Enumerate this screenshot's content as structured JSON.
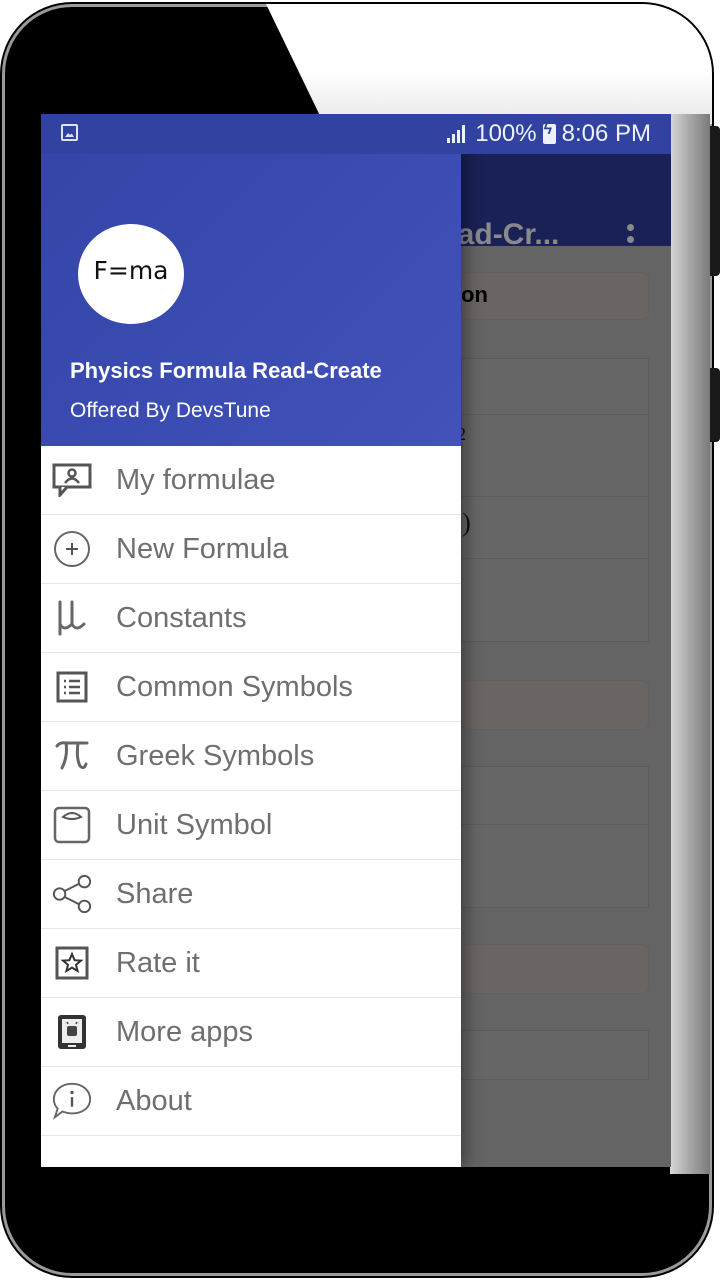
{
  "status_bar": {
    "battery": "100%",
    "time": "8:06 PM",
    "left_icon": "gallery-icon",
    "signal_icon": "signal-icon",
    "battery_icon": "battery-charging-icon"
  },
  "app_behind": {
    "toolbar_title": "Physics Formula Read-Cr...",
    "toolbar_title_visible": "ead-Cr...",
    "overflow_icon": "more-vert-icon",
    "section_heading_fragment": "on",
    "math_fragment_1": "2",
    "math_fragment_2": "₀)"
  },
  "drawer": {
    "logo_text": "F=ma",
    "app_name": "Physics Formula Read-Create",
    "offered_by": "Offered By DevsTune",
    "items": [
      {
        "label": "My formulae",
        "icon": "person-board-icon"
      },
      {
        "label": "New Formula",
        "icon": "add-circle-icon"
      },
      {
        "label": "Constants",
        "icon": "mu-icon"
      },
      {
        "label": "Common Symbols",
        "icon": "list-icon"
      },
      {
        "label": "Greek Symbols",
        "icon": "pi-icon"
      },
      {
        "label": "Unit Symbol",
        "icon": "scale-icon"
      },
      {
        "label": "Share",
        "icon": "share-icon"
      },
      {
        "label": "Rate it",
        "icon": "star-box-icon"
      },
      {
        "label": "More apps",
        "icon": "android-tablet-icon"
      },
      {
        "label": "About",
        "icon": "info-bubble-icon"
      }
    ]
  },
  "colors": {
    "primary": "#3445a6",
    "primary_dark": "#1a2156",
    "menu_text": "#6f6f6f"
  }
}
